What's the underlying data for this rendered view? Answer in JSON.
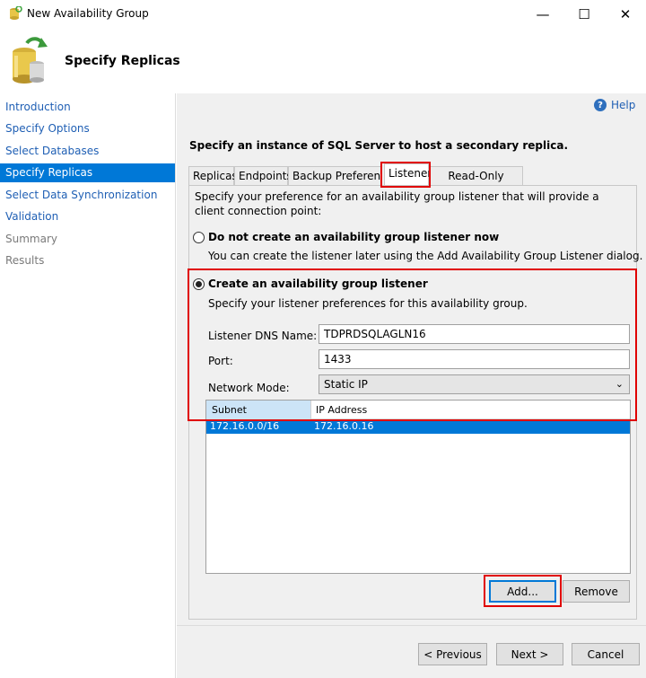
{
  "window": {
    "title": "New Availability Group",
    "minimize_glyph": "—",
    "maximize_glyph": "☐",
    "close_glyph": "✕"
  },
  "header": {
    "title": "Specify Replicas",
    "icon": "database-cylinder-refresh-icon"
  },
  "nav": {
    "items": [
      {
        "label": "Introduction",
        "state": "link"
      },
      {
        "label": "Specify Options",
        "state": "link"
      },
      {
        "label": "Select Databases",
        "state": "link"
      },
      {
        "label": "Specify Replicas",
        "state": "selected"
      },
      {
        "label": "Select Data Synchronization",
        "state": "link"
      },
      {
        "label": "Validation",
        "state": "link"
      },
      {
        "label": "Summary",
        "state": "disabled"
      },
      {
        "label": "Results",
        "state": "disabled"
      }
    ]
  },
  "help": {
    "label": "Help",
    "glyph": "?"
  },
  "main": {
    "prompt": "Specify an instance of SQL Server to host a secondary replica.",
    "tabs": [
      {
        "label": "Replicas"
      },
      {
        "label": "Endpoints"
      },
      {
        "label": "Backup Preferences"
      },
      {
        "label": "Listener",
        "active": true
      },
      {
        "label": "Read-Only Routing"
      }
    ],
    "listener": {
      "description": "Specify your preference for an availability group listener that will provide a client connection point:",
      "option_none": {
        "label": "Do not create an availability group listener now",
        "hint": "You can create the listener later using the Add Availability Group Listener dialog.",
        "selected": false
      },
      "option_create": {
        "label": "Create an availability group listener",
        "hint": "Specify your listener preferences for this availability group.",
        "selected": true
      },
      "dns_label": "Listener DNS Name:",
      "dns_value": "TDPRDSQLAGLN16",
      "port_label": "Port:",
      "port_value": "1433",
      "mode_label": "Network Mode:",
      "mode_value": "Static IP",
      "grid": {
        "columns": [
          "Subnet",
          "IP Address"
        ],
        "rows": [
          {
            "subnet": "172.16.0.0/16",
            "ip": "172.16.0.16"
          }
        ]
      },
      "add_label": "Add...",
      "remove_label": "Remove"
    }
  },
  "footer": {
    "previous_label": "< Previous",
    "next_label": "Next >",
    "cancel_label": "Cancel"
  },
  "colors": {
    "accent": "#0078d7",
    "highlight_box": "#e00000",
    "link": "#1f5fb4"
  }
}
